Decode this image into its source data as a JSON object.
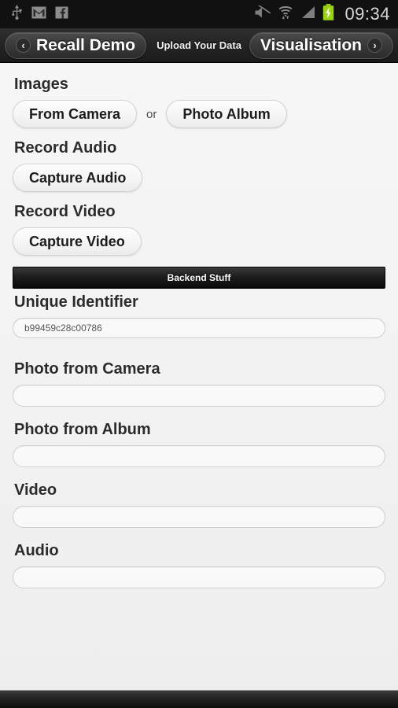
{
  "status_bar": {
    "icons_left": [
      "usb-icon",
      "gmail-icon",
      "facebook-icon"
    ],
    "icons_right": [
      "mute-icon",
      "wifi-icon",
      "signal-icon",
      "battery-charging-icon"
    ],
    "time": "09:34",
    "battery_color": "#9ad216"
  },
  "title_bar": {
    "back_label": "Recall Demo",
    "back_chevron": "‹",
    "page_title": "Upload Your Data",
    "forward_label": "Visualisation",
    "forward_chevron": "›"
  },
  "sections": {
    "images": {
      "heading": "Images",
      "from_camera": "From Camera",
      "or": "or",
      "photo_album": "Photo Album"
    },
    "record_audio": {
      "heading": "Record Audio",
      "button": "Capture Audio"
    },
    "record_video": {
      "heading": "Record Video",
      "button": "Capture Video"
    }
  },
  "backend": {
    "collapsible_label": "Backend Stuff",
    "fields": [
      {
        "label": "Unique Identifier",
        "value": "b99459c28c00786",
        "placeholder": ""
      },
      {
        "label": "Photo from Camera",
        "value": "",
        "placeholder": ""
      },
      {
        "label": "Photo from Album",
        "value": "",
        "placeholder": ""
      },
      {
        "label": "Video",
        "value": "",
        "placeholder": ""
      },
      {
        "label": "Audio",
        "value": "",
        "placeholder": ""
      }
    ]
  }
}
